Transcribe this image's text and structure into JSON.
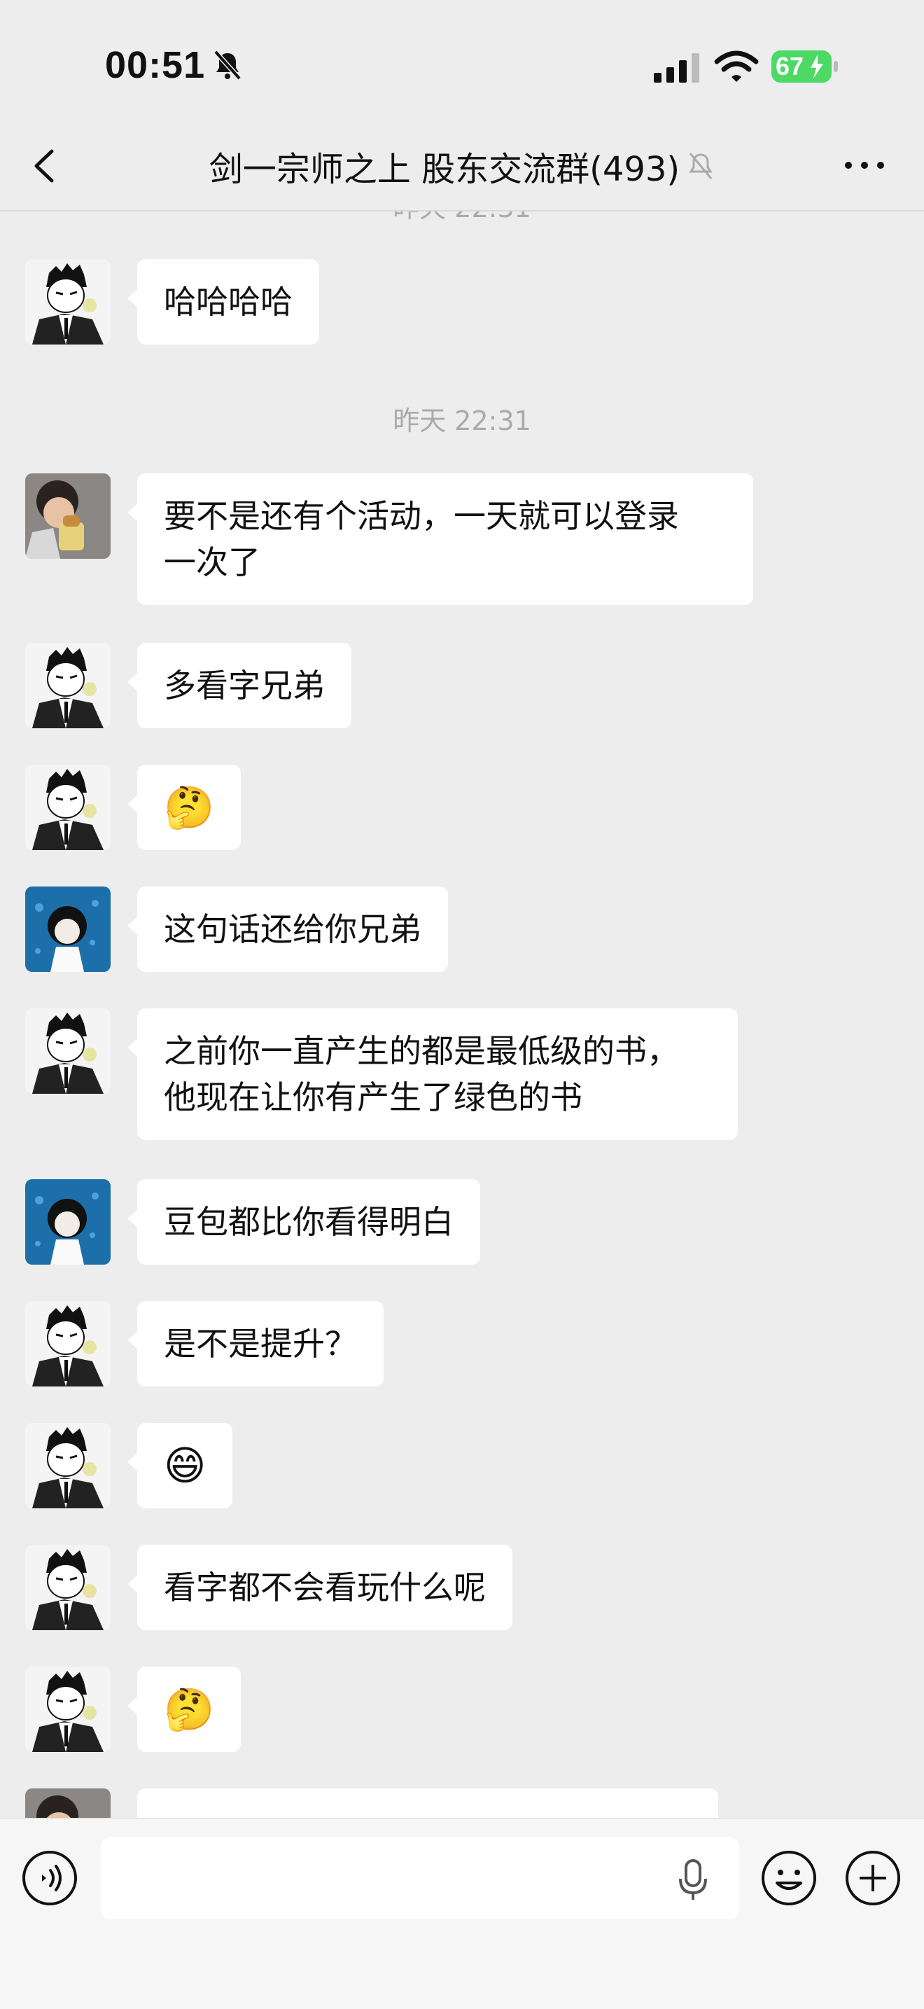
{
  "status_bar": {
    "time": "00:51",
    "battery": "67"
  },
  "header": {
    "title": "剑一宗师之上 股东交流群(493)"
  },
  "timestamps": {
    "partial_top": "昨天 22:31",
    "middle": "昨天 22:31"
  },
  "messages": [
    {
      "sender": "avatar-suit-man",
      "text": "哈哈哈哈"
    },
    {
      "sender": "avatar-child",
      "text": "要不是还有个活动，一天就可以登录一次了"
    },
    {
      "sender": "avatar-suit-man",
      "text": "多看字兄弟"
    },
    {
      "sender": "avatar-suit-man",
      "text": "🤔"
    },
    {
      "sender": "avatar-anime-aquarium",
      "text": "这句话还给你兄弟"
    },
    {
      "sender": "avatar-suit-man",
      "text": "之前你一直产生的都是最低级的书，他现在让你有产生了绿色的书"
    },
    {
      "sender": "avatar-anime-aquarium",
      "text": "豆包都比你看得明白"
    },
    {
      "sender": "avatar-suit-man",
      "text": "是不是提升？"
    },
    {
      "sender": "avatar-suit-man",
      "text": "😄"
    },
    {
      "sender": "avatar-suit-man",
      "text": "看字都不会看玩什么呢"
    },
    {
      "sender": "avatar-suit-man",
      "text": "🤔"
    },
    {
      "sender": "avatar-child",
      "text": ""
    }
  ],
  "message_lines": {
    "m1_l1": "要不是还有个活动，一天就可以登录",
    "m1_l2": "一次了",
    "m5_l1": "之前你一直产生的都是最低级的书，",
    "m5_l2": "他现在让你有产生了绿色的书"
  },
  "composer": {
    "input_value": ""
  },
  "colors": {
    "background": "#ededed",
    "bubble": "#ffffff",
    "battery": "#4cd964",
    "timestamp": "#aaaaaa"
  }
}
